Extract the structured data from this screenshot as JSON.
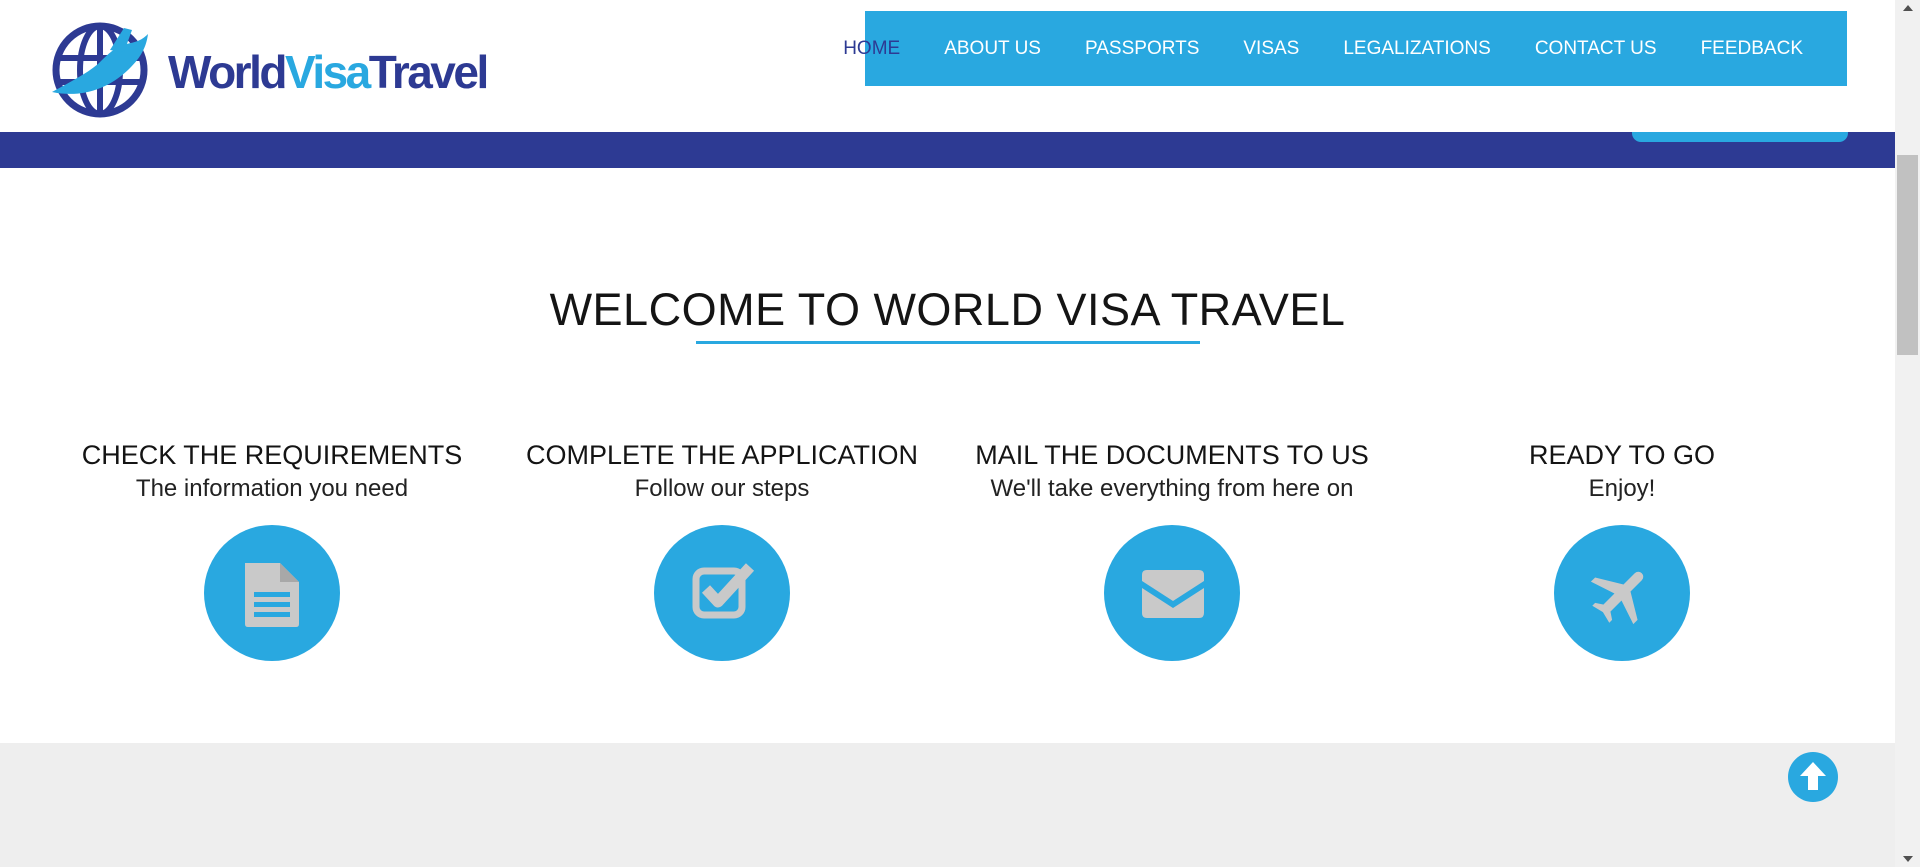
{
  "brand": {
    "logo_words": [
      "World",
      "Visa",
      "Travel"
    ],
    "colors": {
      "navy": "#2d3a93",
      "sky": "#29a8e0",
      "gray_bg": "#eeeeee"
    }
  },
  "nav": {
    "items": [
      {
        "label": "HOME",
        "active": true
      },
      {
        "label": "ABOUT US"
      },
      {
        "label": "PASSPORTS"
      },
      {
        "label": "VISAS"
      },
      {
        "label": "LEGALIZATIONS"
      },
      {
        "label": "CONTACT US"
      },
      {
        "label": "FEEDBACK"
      }
    ]
  },
  "welcome": {
    "title": "WELCOME TO WORLD VISA TRAVEL",
    "steps": [
      {
        "title": "CHECK THE REQUIREMENTS",
        "subtitle": "The information you need",
        "icon": "document-icon"
      },
      {
        "title": "COMPLETE THE APPLICATION",
        "subtitle": "Follow our steps",
        "icon": "checkbox-icon"
      },
      {
        "title": "MAIL THE DOCUMENTS TO US",
        "subtitle": "We'll take everything from here on",
        "icon": "envelope-icon"
      },
      {
        "title": "READY TO GO",
        "subtitle": "Enjoy!",
        "icon": "airplane-icon"
      }
    ]
  },
  "ui": {
    "back_to_top_icon": "arrow-up-circle-icon"
  }
}
